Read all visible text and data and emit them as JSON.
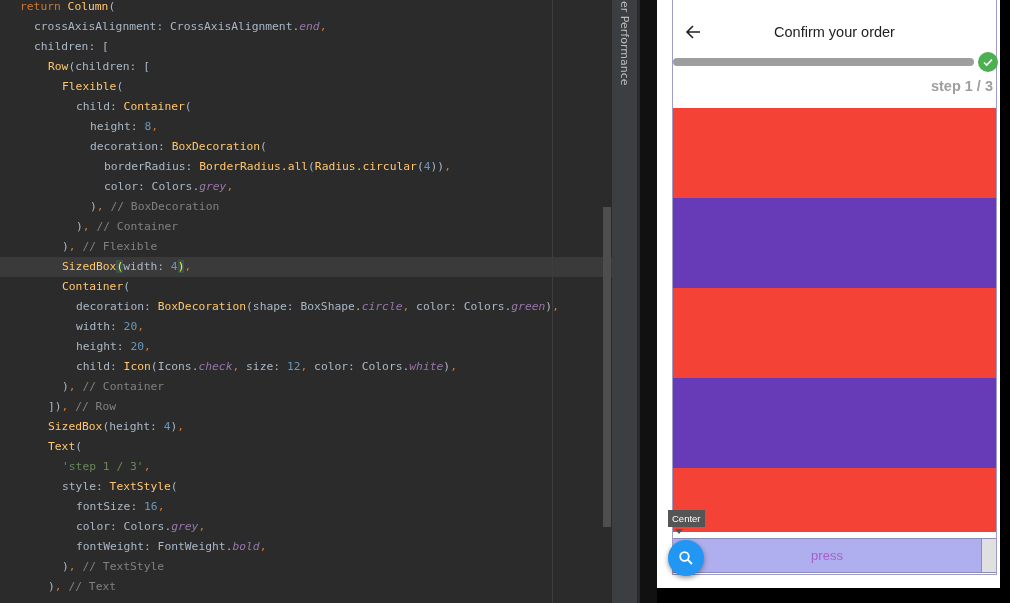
{
  "editor": {
    "lines": [
      {
        "current": false,
        "tokens": [
          {
            "t": "return ",
            "kind": "keyword"
          },
          {
            "t": "Column",
            "kind": "class"
          },
          {
            "t": "(",
            "kind": "plain"
          }
        ],
        "children": [
          {
            "current": false,
            "tokens": [
              {
                "t": "crossAxisAlignment: CrossAxisAlignment.",
                "kind": "plain"
              },
              {
                "t": "end",
                "kind": "const"
              },
              {
                "t": ",",
                "kind": "punct"
              }
            ]
          },
          {
            "current": false,
            "tokens": [
              {
                "t": "children: [",
                "kind": "plain"
              }
            ],
            "children": [
              {
                "current": false,
                "tokens": [
                  {
                    "t": "Row",
                    "kind": "class"
                  },
                  {
                    "t": "(children: [",
                    "kind": "plain"
                  }
                ],
                "children": [
                  {
                    "current": false,
                    "tokens": [
                      {
                        "t": "Flexible",
                        "kind": "class"
                      },
                      {
                        "t": "(",
                        "kind": "plain"
                      }
                    ],
                    "children": [
                      {
                        "current": false,
                        "tokens": [
                          {
                            "t": "child: ",
                            "kind": "plain"
                          },
                          {
                            "t": "Container",
                            "kind": "class"
                          },
                          {
                            "t": "(",
                            "kind": "plain"
                          }
                        ],
                        "children": [
                          {
                            "current": false,
                            "tokens": [
                              {
                                "t": "height: ",
                                "kind": "plain"
                              },
                              {
                                "t": "8",
                                "kind": "number"
                              },
                              {
                                "t": ",",
                                "kind": "punct"
                              }
                            ]
                          },
                          {
                            "current": false,
                            "tokens": [
                              {
                                "t": "decoration: ",
                                "kind": "plain"
                              },
                              {
                                "t": "BoxDecoration",
                                "kind": "class"
                              },
                              {
                                "t": "(",
                                "kind": "plain"
                              }
                            ],
                            "children": [
                              {
                                "current": false,
                                "tokens": [
                                  {
                                    "t": "borderRadius: ",
                                    "kind": "plain"
                                  },
                                  {
                                    "t": "BorderRadius.all",
                                    "kind": "class"
                                  },
                                  {
                                    "t": "(",
                                    "kind": "plain"
                                  },
                                  {
                                    "t": "Radius.circular",
                                    "kind": "class"
                                  },
                                  {
                                    "t": "(",
                                    "kind": "plain"
                                  },
                                  {
                                    "t": "4",
                                    "kind": "number"
                                  },
                                  {
                                    "t": "))",
                                    "kind": "plain"
                                  },
                                  {
                                    "t": ",",
                                    "kind": "punct"
                                  }
                                ]
                              },
                              {
                                "current": false,
                                "tokens": [
                                  {
                                    "t": "color: Colors.",
                                    "kind": "plain"
                                  },
                                  {
                                    "t": "grey",
                                    "kind": "const"
                                  },
                                  {
                                    "t": ",",
                                    "kind": "punct"
                                  }
                                ]
                              }
                            ]
                          },
                          {
                            "current": false,
                            "tokens": [
                              {
                                "t": ")",
                                "kind": "plain"
                              },
                              {
                                "t": ", ",
                                "kind": "punct"
                              },
                              {
                                "t": "// BoxDecoration",
                                "kind": "comment"
                              }
                            ]
                          }
                        ]
                      },
                      {
                        "current": false,
                        "tokens": [
                          {
                            "t": ")",
                            "kind": "plain"
                          },
                          {
                            "t": ", ",
                            "kind": "punct"
                          },
                          {
                            "t": "// Container",
                            "kind": "comment"
                          }
                        ]
                      }
                    ]
                  },
                  {
                    "current": false,
                    "tokens": [
                      {
                        "t": ")",
                        "kind": "plain"
                      },
                      {
                        "t": ", ",
                        "kind": "punct"
                      },
                      {
                        "t": "// Flexible",
                        "kind": "comment"
                      }
                    ]
                  },
                  {
                    "current": true,
                    "tokens": [
                      {
                        "t": "SizedBox",
                        "kind": "class"
                      },
                      {
                        "t": "(",
                        "kind": "match"
                      },
                      {
                        "t": "width: ",
                        "kind": "plain"
                      },
                      {
                        "t": "4",
                        "kind": "number"
                      },
                      {
                        "t": ")",
                        "kind": "match"
                      },
                      {
                        "t": ",",
                        "kind": "punct"
                      }
                    ]
                  },
                  {
                    "current": false,
                    "tokens": [
                      {
                        "t": "Container",
                        "kind": "class"
                      },
                      {
                        "t": "(",
                        "kind": "plain"
                      }
                    ],
                    "children": [
                      {
                        "current": false,
                        "tokens": [
                          {
                            "t": "decoration: ",
                            "kind": "plain"
                          },
                          {
                            "t": "BoxDecoration",
                            "kind": "class"
                          },
                          {
                            "t": "(shape: BoxShape.",
                            "kind": "plain"
                          },
                          {
                            "t": "circle",
                            "kind": "const"
                          },
                          {
                            "t": ", ",
                            "kind": "punct"
                          },
                          {
                            "t": "color: Colors.",
                            "kind": "plain"
                          },
                          {
                            "t": "green",
                            "kind": "const"
                          },
                          {
                            "t": ")",
                            "kind": "plain"
                          },
                          {
                            "t": ",",
                            "kind": "punct"
                          }
                        ]
                      },
                      {
                        "current": false,
                        "tokens": [
                          {
                            "t": "width: ",
                            "kind": "plain"
                          },
                          {
                            "t": "20",
                            "kind": "number"
                          },
                          {
                            "t": ",",
                            "kind": "punct"
                          }
                        ]
                      },
                      {
                        "current": false,
                        "tokens": [
                          {
                            "t": "height: ",
                            "kind": "plain"
                          },
                          {
                            "t": "20",
                            "kind": "number"
                          },
                          {
                            "t": ",",
                            "kind": "punct"
                          }
                        ]
                      },
                      {
                        "current": false,
                        "tokens": [
                          {
                            "t": "child: ",
                            "kind": "plain"
                          },
                          {
                            "t": "Icon",
                            "kind": "class"
                          },
                          {
                            "t": "(Icons.",
                            "kind": "plain"
                          },
                          {
                            "t": "check",
                            "kind": "const"
                          },
                          {
                            "t": ", ",
                            "kind": "punct"
                          },
                          {
                            "t": "size: ",
                            "kind": "plain"
                          },
                          {
                            "t": "12",
                            "kind": "number"
                          },
                          {
                            "t": ", ",
                            "kind": "punct"
                          },
                          {
                            "t": "color: Colors.",
                            "kind": "plain"
                          },
                          {
                            "t": "white",
                            "kind": "const"
                          },
                          {
                            "t": ")",
                            "kind": "plain"
                          },
                          {
                            "t": ",",
                            "kind": "punct"
                          }
                        ]
                      }
                    ]
                  },
                  {
                    "current": false,
                    "tokens": [
                      {
                        "t": ")",
                        "kind": "plain"
                      },
                      {
                        "t": ", ",
                        "kind": "punct"
                      },
                      {
                        "t": "// Container",
                        "kind": "comment"
                      }
                    ]
                  }
                ]
              },
              {
                "current": false,
                "tokens": [
                  {
                    "t": "])",
                    "kind": "plain"
                  },
                  {
                    "t": ", ",
                    "kind": "punct"
                  },
                  {
                    "t": "// Row",
                    "kind": "comment"
                  }
                ]
              },
              {
                "current": false,
                "tokens": [
                  {
                    "t": "SizedBox",
                    "kind": "class"
                  },
                  {
                    "t": "(height: ",
                    "kind": "plain"
                  },
                  {
                    "t": "4",
                    "kind": "number"
                  },
                  {
                    "t": ")",
                    "kind": "plain"
                  },
                  {
                    "t": ",",
                    "kind": "punct"
                  }
                ]
              },
              {
                "current": false,
                "tokens": [
                  {
                    "t": "Text",
                    "kind": "class"
                  },
                  {
                    "t": "(",
                    "kind": "plain"
                  }
                ],
                "children": [
                  {
                    "current": false,
                    "tokens": [
                      {
                        "t": "'step 1 / 3'",
                        "kind": "string"
                      },
                      {
                        "t": ",",
                        "kind": "punct"
                      }
                    ]
                  },
                  {
                    "current": false,
                    "tokens": [
                      {
                        "t": "style: ",
                        "kind": "plain"
                      },
                      {
                        "t": "TextStyle",
                        "kind": "class"
                      },
                      {
                        "t": "(",
                        "kind": "plain"
                      }
                    ],
                    "children": [
                      {
                        "current": false,
                        "tokens": [
                          {
                            "t": "fontSize: ",
                            "kind": "plain"
                          },
                          {
                            "t": "16",
                            "kind": "number"
                          },
                          {
                            "t": ",",
                            "kind": "punct"
                          }
                        ]
                      },
                      {
                        "current": false,
                        "tokens": [
                          {
                            "t": "color: Colors.",
                            "kind": "plain"
                          },
                          {
                            "t": "grey",
                            "kind": "const"
                          },
                          {
                            "t": ",",
                            "kind": "punct"
                          }
                        ]
                      },
                      {
                        "current": false,
                        "tokens": [
                          {
                            "t": "fontWeight: FontWeight.",
                            "kind": "plain"
                          },
                          {
                            "t": "bold",
                            "kind": "const"
                          },
                          {
                            "t": ",",
                            "kind": "punct"
                          }
                        ]
                      }
                    ]
                  },
                  {
                    "current": false,
                    "tokens": [
                      {
                        "t": ")",
                        "kind": "plain"
                      },
                      {
                        "t": ", ",
                        "kind": "punct"
                      },
                      {
                        "t": "// TextStyle",
                        "kind": "comment"
                      }
                    ]
                  }
                ]
              },
              {
                "current": false,
                "tokens": [
                  {
                    "t": ")",
                    "kind": "plain"
                  },
                  {
                    "t": ", ",
                    "kind": "punct"
                  },
                  {
                    "t": "// Text",
                    "kind": "comment"
                  }
                ]
              }
            ]
          }
        ]
      }
    ]
  },
  "side_tab": {
    "label": "er Performance"
  },
  "app": {
    "app_bar": {
      "title": "Confirm your order"
    },
    "step_label": "step 1 / 3",
    "stripes": [
      {
        "color": "#f44336"
      },
      {
        "color": "#673ab7"
      },
      {
        "color": "#f44336"
      },
      {
        "color": "#673ab7"
      },
      {
        "color": "#f44336"
      }
    ],
    "button": {
      "label": "press"
    },
    "tooltip": {
      "text": "Center"
    }
  }
}
